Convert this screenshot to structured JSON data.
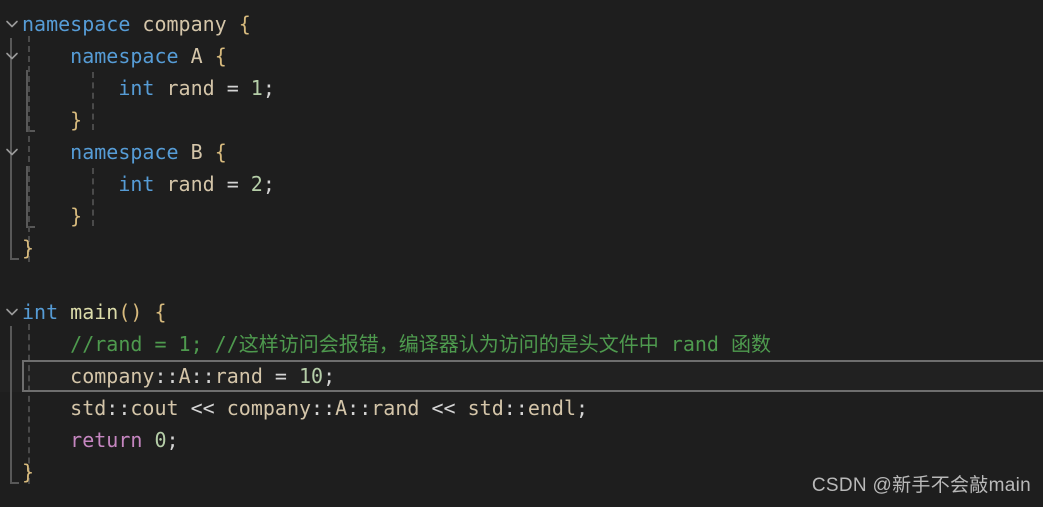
{
  "editor": {
    "theme": "vscode-dark-plus",
    "background_color": "#1e1e1e",
    "language": "cpp",
    "current_line_number": 11,
    "colors": {
      "keyword": "#569cd6",
      "identifier": "#d4c5a9",
      "function": "#dcdcaa",
      "number": "#b5cea8",
      "operator": "#d4d4d4",
      "brace": "#d7ba7d",
      "comment": "#4e9a4e",
      "control_keyword": "#c586c0",
      "current_line_border": "#6e6e6e",
      "indent_guide": "#4a4a4a",
      "bracket_guide": "#585858"
    }
  },
  "code": {
    "lines": [
      {
        "id": "line-1",
        "folded": false,
        "fold_icon": "chevron-down-icon",
        "tokens": [
          {
            "t": "namespace",
            "c": "k"
          },
          {
            "t": " ",
            "c": "op"
          },
          {
            "t": "company",
            "c": "id"
          },
          {
            "t": " ",
            "c": "op"
          },
          {
            "t": "{",
            "c": "br"
          }
        ]
      },
      {
        "id": "line-2",
        "folded": false,
        "fold_icon": "chevron-down-icon",
        "tokens": [
          {
            "t": "    ",
            "c": "op"
          },
          {
            "t": "namespace",
            "c": "k"
          },
          {
            "t": " ",
            "c": "op"
          },
          {
            "t": "A",
            "c": "id"
          },
          {
            "t": " ",
            "c": "op"
          },
          {
            "t": "{",
            "c": "br"
          }
        ]
      },
      {
        "id": "line-3",
        "folded": false,
        "fold_icon": "",
        "tokens": [
          {
            "t": "        ",
            "c": "op"
          },
          {
            "t": "int",
            "c": "k"
          },
          {
            "t": " ",
            "c": "op"
          },
          {
            "t": "rand",
            "c": "id"
          },
          {
            "t": " = ",
            "c": "op"
          },
          {
            "t": "1",
            "c": "num"
          },
          {
            "t": ";",
            "c": "op"
          }
        ]
      },
      {
        "id": "line-4",
        "folded": false,
        "fold_icon": "",
        "tokens": [
          {
            "t": "    ",
            "c": "op"
          },
          {
            "t": "}",
            "c": "br"
          }
        ]
      },
      {
        "id": "line-5",
        "folded": false,
        "fold_icon": "chevron-down-icon",
        "tokens": [
          {
            "t": "    ",
            "c": "op"
          },
          {
            "t": "namespace",
            "c": "k"
          },
          {
            "t": " ",
            "c": "op"
          },
          {
            "t": "B",
            "c": "id"
          },
          {
            "t": " ",
            "c": "op"
          },
          {
            "t": "{",
            "c": "br"
          }
        ]
      },
      {
        "id": "line-6",
        "folded": false,
        "fold_icon": "",
        "tokens": [
          {
            "t": "        ",
            "c": "op"
          },
          {
            "t": "int",
            "c": "k"
          },
          {
            "t": " ",
            "c": "op"
          },
          {
            "t": "rand",
            "c": "id"
          },
          {
            "t": " = ",
            "c": "op"
          },
          {
            "t": "2",
            "c": "num"
          },
          {
            "t": ";",
            "c": "op"
          }
        ]
      },
      {
        "id": "line-7",
        "folded": false,
        "fold_icon": "",
        "tokens": [
          {
            "t": "    ",
            "c": "op"
          },
          {
            "t": "}",
            "c": "br"
          }
        ]
      },
      {
        "id": "line-8",
        "folded": false,
        "fold_icon": "",
        "tokens": [
          {
            "t": "}",
            "c": "br"
          }
        ]
      },
      {
        "id": "line-9",
        "folded": false,
        "fold_icon": "",
        "tokens": []
      },
      {
        "id": "line-10",
        "folded": false,
        "fold_icon": "chevron-down-icon",
        "tokens": [
          {
            "t": "int",
            "c": "k"
          },
          {
            "t": " ",
            "c": "op"
          },
          {
            "t": "main",
            "c": "fn"
          },
          {
            "t": "()",
            "c": "br"
          },
          {
            "t": " ",
            "c": "op"
          },
          {
            "t": "{",
            "c": "br"
          }
        ]
      },
      {
        "id": "line-11",
        "folded": false,
        "fold_icon": "",
        "tokens": [
          {
            "t": "    ",
            "c": "op"
          },
          {
            "t": "//rand = 1; //这样访问会报错，编译器认为访问的是头文件中 rand 函数",
            "c": "cm"
          }
        ]
      },
      {
        "id": "line-12",
        "folded": false,
        "fold_icon": "",
        "highlighted": true,
        "tokens": [
          {
            "t": "    ",
            "c": "op"
          },
          {
            "t": "company",
            "c": "id"
          },
          {
            "t": "::",
            "c": "op"
          },
          {
            "t": "A",
            "c": "id"
          },
          {
            "t": "::",
            "c": "op"
          },
          {
            "t": "rand",
            "c": "id"
          },
          {
            "t": " = ",
            "c": "op"
          },
          {
            "t": "10",
            "c": "num"
          },
          {
            "t": ";",
            "c": "op"
          }
        ]
      },
      {
        "id": "line-13",
        "folded": false,
        "fold_icon": "",
        "tokens": [
          {
            "t": "    ",
            "c": "op"
          },
          {
            "t": "std",
            "c": "id"
          },
          {
            "t": "::",
            "c": "op"
          },
          {
            "t": "cout",
            "c": "id"
          },
          {
            "t": " << ",
            "c": "op"
          },
          {
            "t": "company",
            "c": "id"
          },
          {
            "t": "::",
            "c": "op"
          },
          {
            "t": "A",
            "c": "id"
          },
          {
            "t": "::",
            "c": "op"
          },
          {
            "t": "rand",
            "c": "id"
          },
          {
            "t": " << ",
            "c": "op"
          },
          {
            "t": "std",
            "c": "id"
          },
          {
            "t": "::",
            "c": "op"
          },
          {
            "t": "endl",
            "c": "id"
          },
          {
            "t": ";",
            "c": "op"
          }
        ]
      },
      {
        "id": "line-14",
        "folded": false,
        "fold_icon": "",
        "tokens": [
          {
            "t": "    ",
            "c": "op"
          },
          {
            "t": "return",
            "c": "ctl"
          },
          {
            "t": " ",
            "c": "op"
          },
          {
            "t": "0",
            "c": "num"
          },
          {
            "t": ";",
            "c": "op"
          }
        ]
      },
      {
        "id": "line-15",
        "folded": false,
        "fold_icon": "",
        "tokens": [
          {
            "t": "}",
            "c": "br"
          }
        ]
      }
    ]
  },
  "watermark": {
    "text": "CSDN @新手不会敲main"
  }
}
